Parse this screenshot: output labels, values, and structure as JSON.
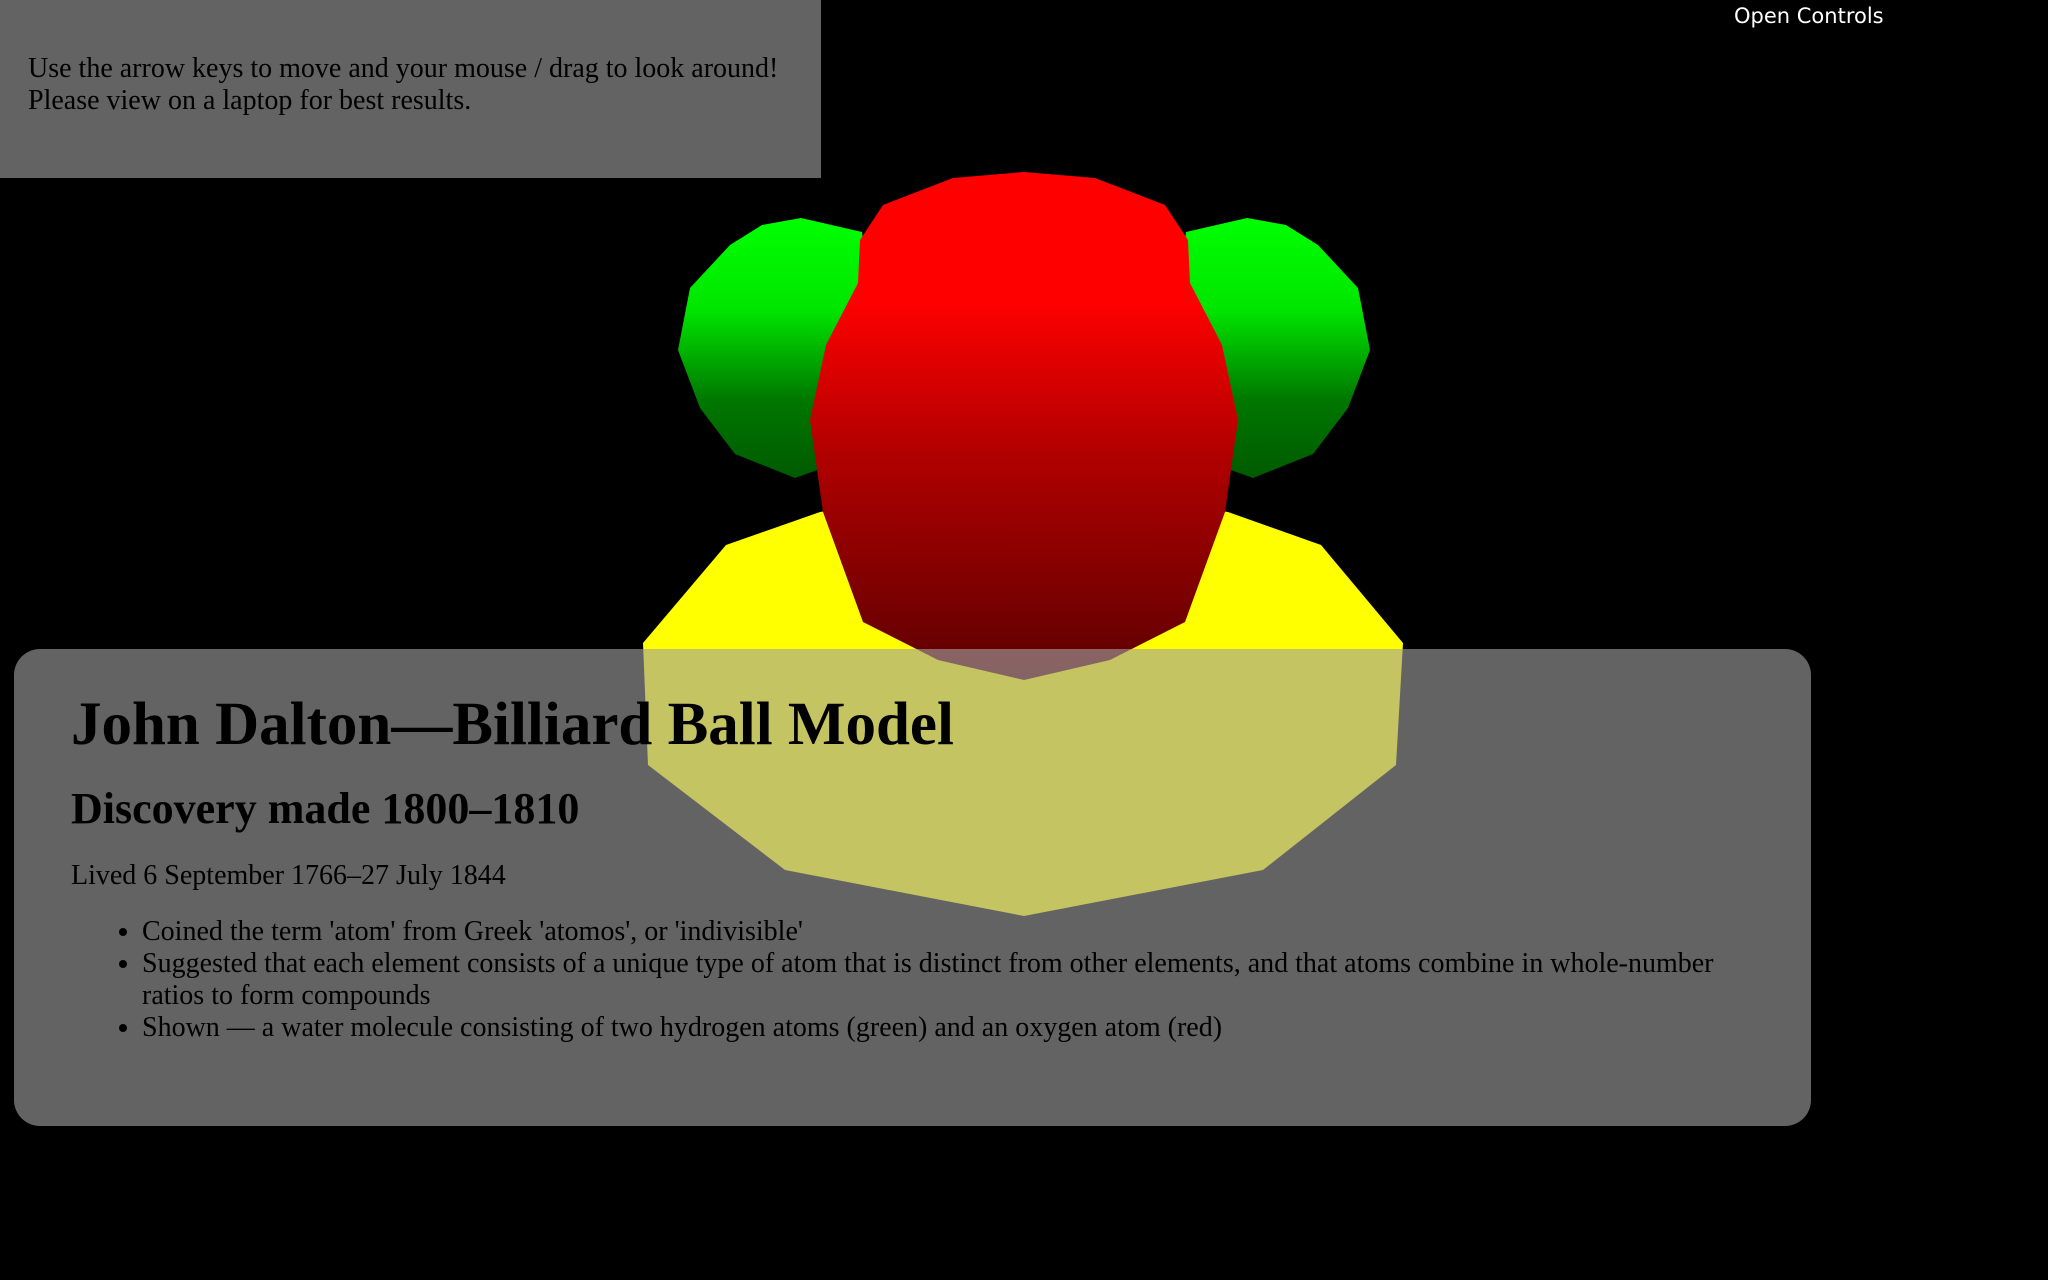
{
  "instructions": {
    "line1": "Use the arrow keys to move and your mouse / drag to look around!",
    "line2": "Please view on a laptop for best results."
  },
  "controls": {
    "open_label": "Open Controls"
  },
  "info": {
    "title": "John Dalton—Billiard Ball Model",
    "subtitle": "Discovery made 1800–1810",
    "lifespan": "Lived 6 September 1766–27 July 1844",
    "bullets": [
      "Coined the term 'atom' from Greek 'atomos', or 'indivisible'",
      "Suggested that each element consists of a unique type of atom that is distinct from other elements, and that atoms combine in whole-number ratios to form compounds",
      "Shown — a water molecule consisting of two hydrogen atoms (green) and an oxygen atom (red)"
    ]
  },
  "scene": {
    "colors": {
      "background": "#000000",
      "oxygen": "#ff0000",
      "hydrogen": "#00ff00",
      "base": "#ffff00",
      "panel": "#a0a0a0"
    }
  }
}
